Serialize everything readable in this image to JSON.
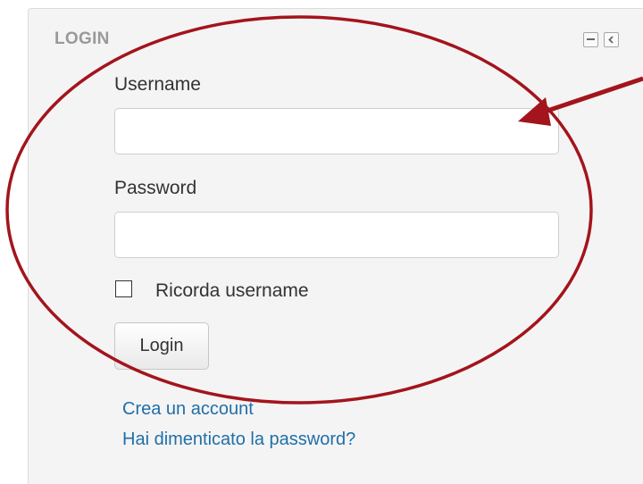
{
  "block": {
    "title": "LOGIN",
    "controls": [
      "minus-icon",
      "chevron-left-icon"
    ]
  },
  "form": {
    "username_label": "Username",
    "username_value": "",
    "password_label": "Password",
    "password_value": "",
    "remember_label": "Ricorda username",
    "remember_checked": false,
    "submit_label": "Login"
  },
  "links": {
    "create_account": "Crea un account",
    "forgot_password": "Hai dimenticato la password?"
  },
  "colors": {
    "annotation": "#a3141d",
    "link": "#1f6fa8",
    "block_bg": "#f4f4f4"
  }
}
